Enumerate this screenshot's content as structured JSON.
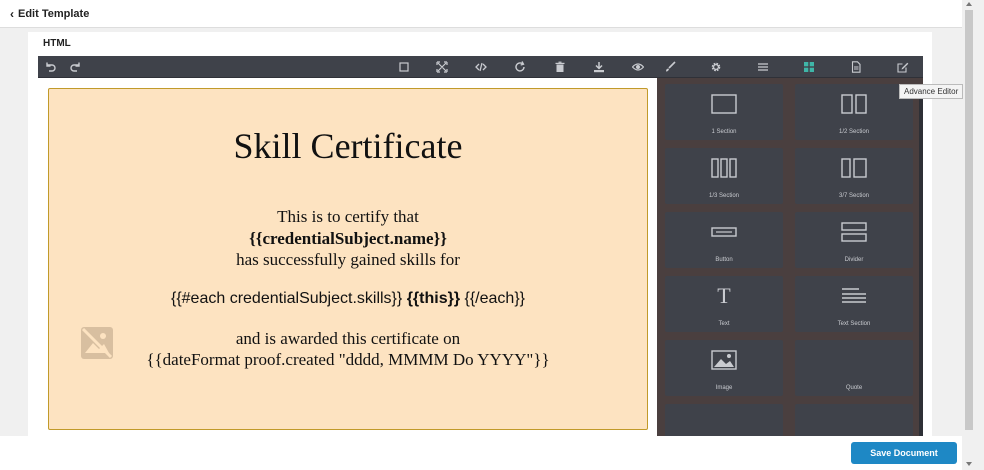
{
  "header": {
    "back_label": "Edit Template"
  },
  "section_label": "HTML",
  "toolbar": {
    "left": [
      "undo-icon",
      "redo-icon"
    ],
    "right": [
      "square-icon",
      "fullscreen-icon",
      "code-icon",
      "refresh-icon",
      "trash-icon",
      "download-icon",
      "eye-icon",
      "brush-icon",
      "gear-icon",
      "menu-icon",
      "grid-icon",
      "document-icon",
      "edit-icon"
    ],
    "active": "grid-icon"
  },
  "certificate": {
    "title": "Skill Certificate",
    "line1": "This is to certify that",
    "line2": "{{credentialSubject.name}}",
    "line3": "has successfully gained skills for",
    "line4_prefix": "{{#each credentialSubject.skills}} ",
    "line4_bold": "{{this}}",
    "line4_suffix": " {{/each}}",
    "line5": "and is awarded this certificate on",
    "line6": "{{dateFormat proof.created \"dddd, MMMM Do YYYY\"}}"
  },
  "blocks": [
    {
      "label": "1 Section",
      "icon": "one-section-icon"
    },
    {
      "label": "1/2 Section",
      "icon": "half-section-icon"
    },
    {
      "label": "1/3 Section",
      "icon": "third-section-icon"
    },
    {
      "label": "3/7 Section",
      "icon": "three-seven-section-icon"
    },
    {
      "label": "Button",
      "icon": "button-icon"
    },
    {
      "label": "Divider",
      "icon": "divider-icon"
    },
    {
      "label": "Text",
      "icon": "text-icon"
    },
    {
      "label": "Text Section",
      "icon": "text-section-icon"
    },
    {
      "label": "Image",
      "icon": "image-icon"
    },
    {
      "label": "Quote",
      "icon": "quote-icon"
    }
  ],
  "tooltip": "Advance Editor",
  "save_label": "Save Document"
}
